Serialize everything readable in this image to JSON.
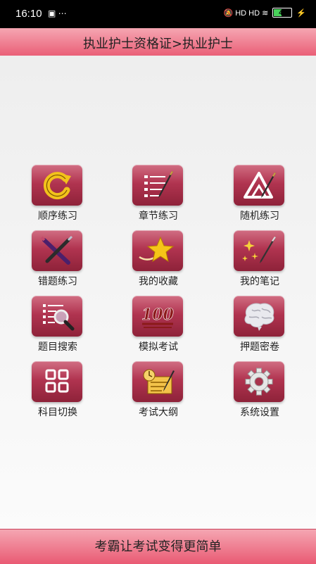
{
  "status_bar": {
    "time": "16:10",
    "battery": "43",
    "left_icons": "▣ ⋯",
    "right_icons": "🔕 HD HD ≋"
  },
  "header": {
    "title": "执业护士资格证>执业护士"
  },
  "grid": {
    "items": [
      {
        "label": "顺序练习",
        "icon": "sequence-arrow-icon"
      },
      {
        "label": "章节练习",
        "icon": "chapter-list-pen-icon"
      },
      {
        "label": "随机练习",
        "icon": "random-pen-icon"
      },
      {
        "label": "错题练习",
        "icon": "wrong-cross-icon"
      },
      {
        "label": "我的收藏",
        "icon": "star-icon"
      },
      {
        "label": "我的笔记",
        "icon": "notes-sparkle-icon"
      },
      {
        "label": "题目搜索",
        "icon": "search-magnifier-icon"
      },
      {
        "label": "模拟考试",
        "icon": "score-100-icon"
      },
      {
        "label": "押题密卷",
        "icon": "brain-icon"
      },
      {
        "label": "科目切换",
        "icon": "grid-switch-icon"
      },
      {
        "label": "考试大纲",
        "icon": "syllabus-icon"
      },
      {
        "label": "系统设置",
        "icon": "gear-icon"
      }
    ]
  },
  "footer": {
    "text": "考霸让考试变得更简单"
  }
}
